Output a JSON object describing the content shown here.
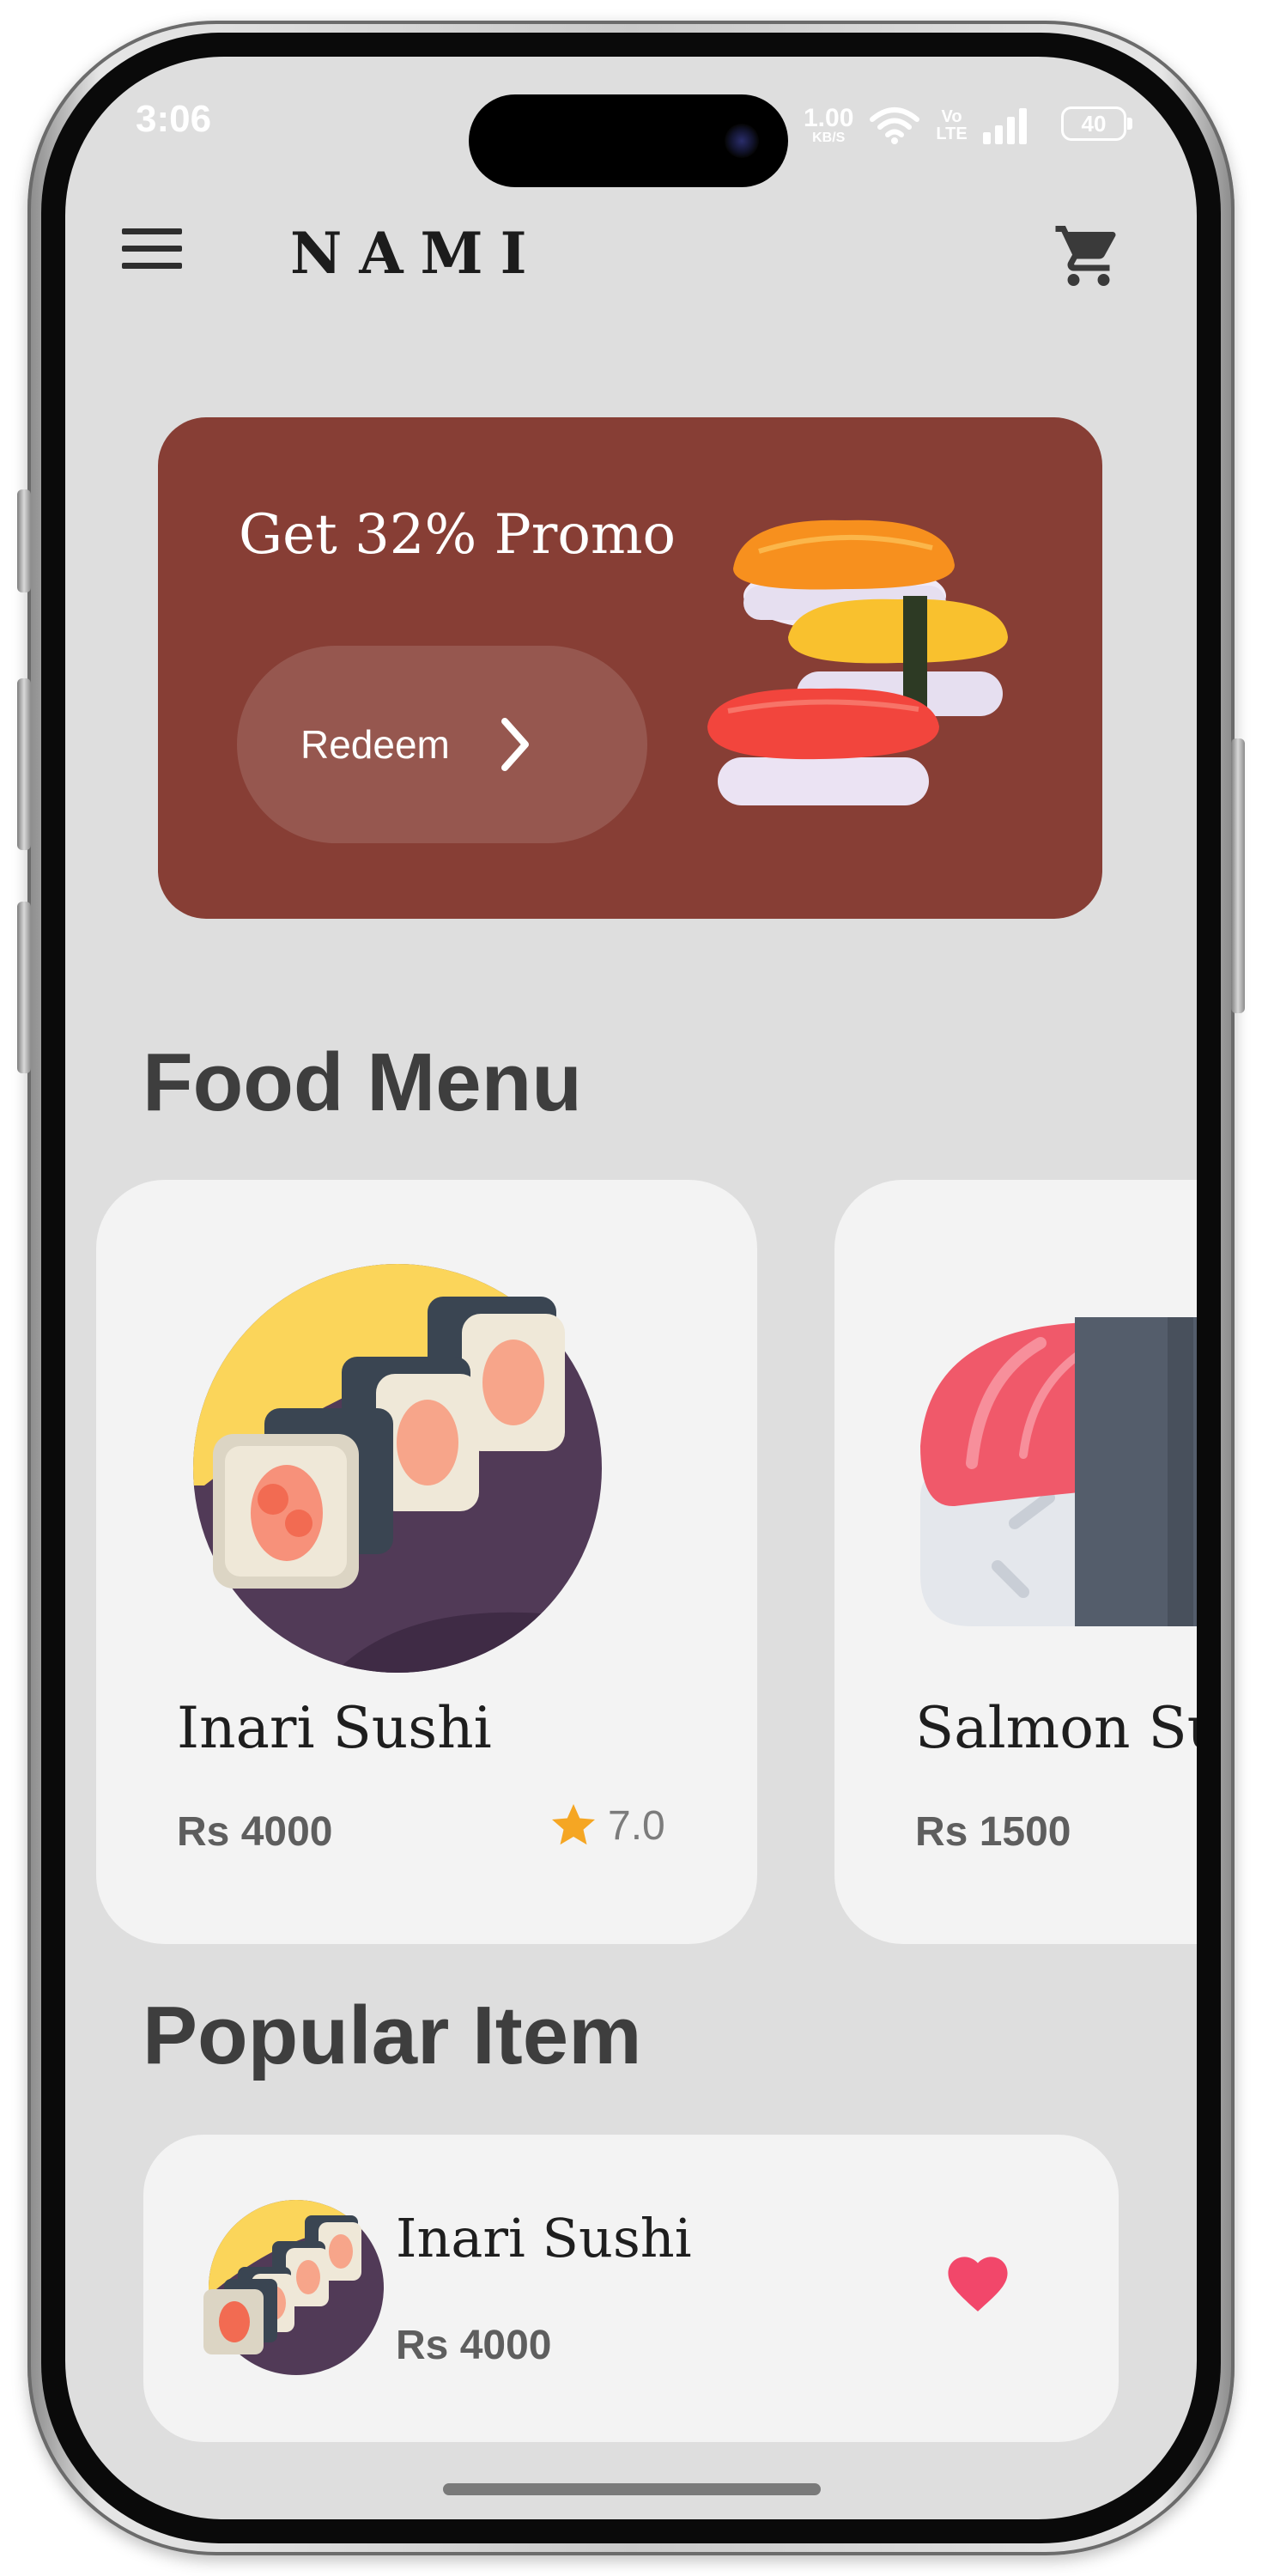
{
  "status_bar": {
    "time": "3:06",
    "net_speed_value": "1.00",
    "net_speed_unit": "KB/S",
    "volte_top": "Vo",
    "volte_bottom": "LTE",
    "battery": "40"
  },
  "header": {
    "brand": "NAMI",
    "menu_icon": "hamburger-menu-icon",
    "cart_icon": "shopping-cart-icon"
  },
  "promo": {
    "title": "Get 32% Promo",
    "button_label": "Redeem",
    "background_color": "#873e35"
  },
  "food_menu": {
    "title": "Food Menu",
    "items": [
      {
        "name": "Inari Sushi",
        "price": "Rs 4000",
        "rating": "7.0"
      },
      {
        "name": "Salmon Sushi",
        "price": "Rs 1500"
      }
    ]
  },
  "popular": {
    "title": "Popular Item",
    "items": [
      {
        "name": "Inari Sushi",
        "price": "Rs 4000"
      }
    ]
  },
  "colors": {
    "accent_heart": "#f2476a",
    "star": "#f5a623"
  }
}
